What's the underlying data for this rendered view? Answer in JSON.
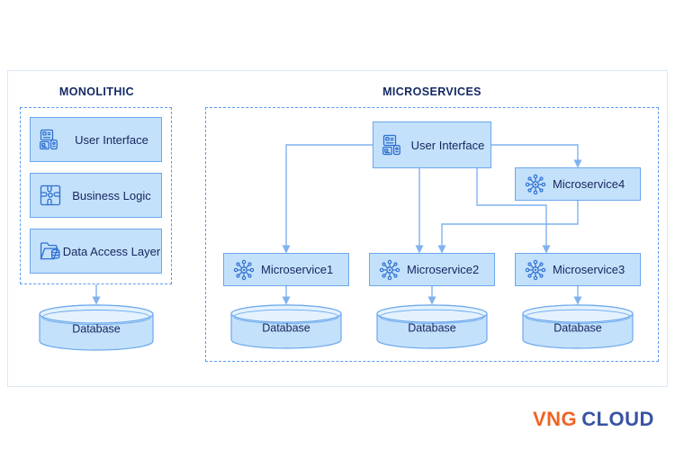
{
  "diagram": {
    "sections": {
      "monolithic": {
        "title": "MONOLITHIC",
        "components": [
          {
            "label": "User Interface",
            "icon": "user-interface-icon"
          },
          {
            "label": "Business Logic",
            "icon": "puzzle-piece-icon"
          },
          {
            "label": "Data Access Layer",
            "icon": "folder-database-icon"
          }
        ],
        "database": {
          "label": "Database",
          "icon": "database-cylinder-icon"
        }
      },
      "microservices": {
        "title": "MICROSERVICES",
        "ui": {
          "label": "User Interface",
          "icon": "user-interface-icon"
        },
        "services": [
          {
            "label": "Microservice1",
            "icon": "service-hub-icon",
            "database": "Database"
          },
          {
            "label": "Microservice2",
            "icon": "service-hub-icon",
            "database": "Database"
          },
          {
            "label": "Microservice3",
            "icon": "service-hub-icon",
            "database": "Database"
          },
          {
            "label": "Microservice4",
            "icon": "service-hub-icon",
            "database": null
          }
        ]
      }
    },
    "colors": {
      "box_fill": "#c3e1fb",
      "box_border": "#6ba7ec",
      "dashed_border": "#5a9bf0",
      "text": "#16255e",
      "connector": "#7fb2ef",
      "frame": "#dce9f8"
    }
  },
  "logo": {
    "primary_text": "VNG",
    "secondary_text": "CLOUD",
    "primary_color": "#ef6524",
    "secondary_color": "#3853a4"
  }
}
